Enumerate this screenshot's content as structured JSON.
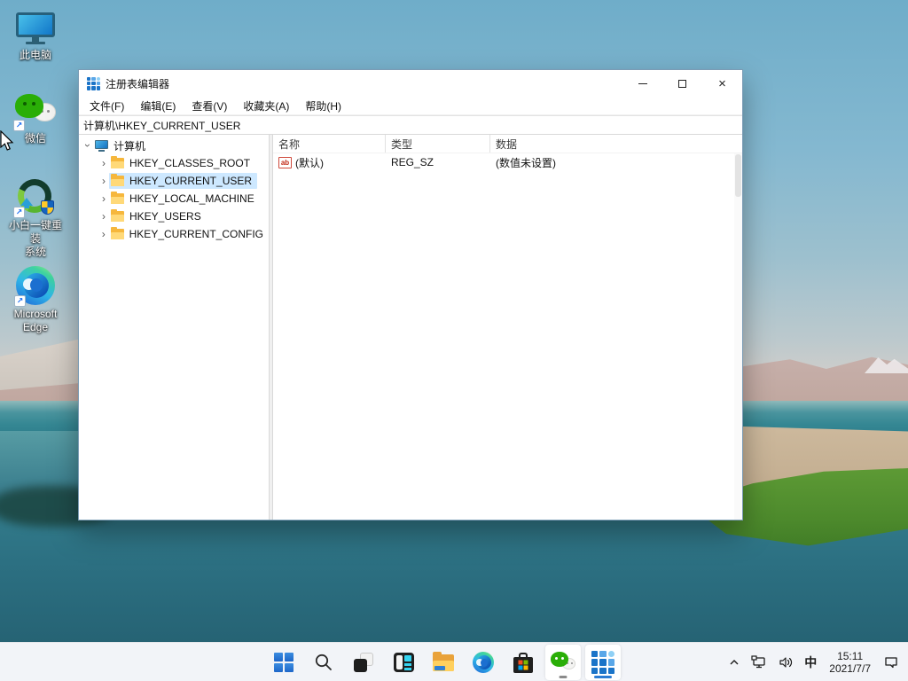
{
  "desktop_icons": [
    {
      "id": "this-pc",
      "label": "此电脑",
      "shortcut": false
    },
    {
      "id": "wechat",
      "label": "微信",
      "shortcut": true
    },
    {
      "id": "xiaobai-reinstall",
      "label_line1": "小白一键重装",
      "label_line2": "系统",
      "shortcut": true
    },
    {
      "id": "microsoft-edge",
      "label_line1": "Microsoft",
      "label_line2": "Edge",
      "shortcut": true
    }
  ],
  "window": {
    "title": "注册表编辑器",
    "menu_items": [
      "文件(F)",
      "编辑(E)",
      "查看(V)",
      "收藏夹(A)",
      "帮助(H)"
    ],
    "address": "计算机\\HKEY_CURRENT_USER",
    "tree": {
      "root": "计算机",
      "items": [
        "HKEY_CLASSES_ROOT",
        "HKEY_CURRENT_USER",
        "HKEY_LOCAL_MACHINE",
        "HKEY_USERS",
        "HKEY_CURRENT_CONFIG"
      ],
      "selected_index": 1
    },
    "list": {
      "columns": [
        "名称",
        "类型",
        "数据"
      ],
      "rows": [
        {
          "name": "(默认)",
          "type": "REG_SZ",
          "data": "(数值未设置)"
        }
      ]
    }
  },
  "taskbar": {
    "items": [
      "start",
      "search",
      "task-view",
      "widgets",
      "file-explorer",
      "edge",
      "microsoft-store",
      "wechat",
      "registry-editor"
    ],
    "running": [
      "wechat",
      "registry-editor"
    ],
    "active": "registry-editor"
  },
  "tray": {
    "input_method": "中",
    "time": "15:11",
    "date": "2021/7/7"
  },
  "glyphs": {
    "chevron": "›",
    "close": "×",
    "shortcut_arrow": "↗",
    "ab_value": "ab"
  },
  "colors": {
    "selection": "#cde8ff",
    "active_indicator": "#2b7cd3",
    "taskbar_bg": "#f3f6fa",
    "window_border": "#7b9cb5"
  }
}
